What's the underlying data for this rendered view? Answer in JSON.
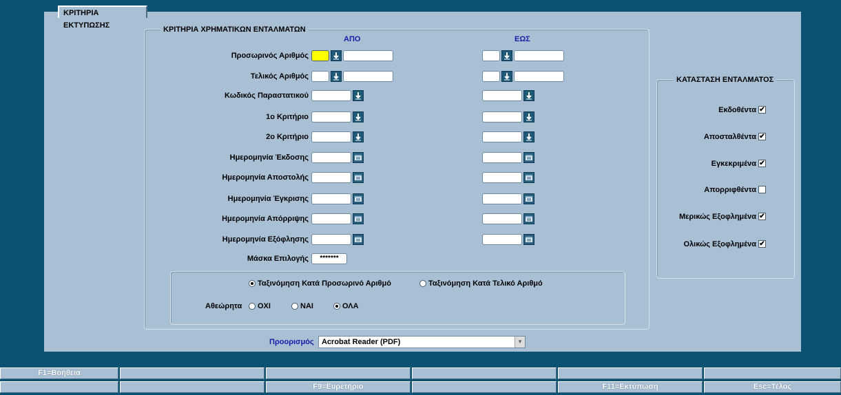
{
  "main_tab": "ΚΡΙΤΗΡΙΑ ΕΚΤΥΠΩΣΗΣ",
  "criteria": {
    "title": "ΚΡΙΤΗΡΙΑ ΧΡΗΜΑΤΙΚΩΝ ΕΝΤΑΛΜΑΤΩΝ",
    "from_label": "ΑΠΟ",
    "to_label": "ΕΩΣ",
    "rows": [
      {
        "label": "Προσωρινός Αριθμός",
        "type": "split-dropdown"
      },
      {
        "label": "Τελικός Αριθμός",
        "type": "split-dropdown"
      },
      {
        "label": "Κωδικός Παραστατικού",
        "type": "dropdown"
      },
      {
        "label": "1ο Κριτήριο",
        "type": "dropdown"
      },
      {
        "label": "2ο Κριτήριο",
        "type": "dropdown"
      },
      {
        "label": "Ημερομηνία Έκδοσης",
        "type": "date"
      },
      {
        "label": "Ημερομηνία Αποστολής",
        "type": "date"
      },
      {
        "label": "Ημερομηνία Έγκρισης",
        "type": "date"
      },
      {
        "label": "Ημερομηνία Απόρριψης",
        "type": "date"
      },
      {
        "label": "Ημερομηνία Εξόφλησης",
        "type": "date"
      }
    ],
    "mask_label": "Μάσκα Επιλογής",
    "mask_value": "*******"
  },
  "sort": {
    "option1": "Ταξινόμηση Κατά Προσωρινό Αριθμό",
    "option2": "Ταξινόμηση Κατά Τελικό Αριθμό",
    "selected": "option1"
  },
  "unchecked": {
    "label": "Αθεώρητα",
    "options": [
      "ΟΧΙ",
      "ΝΑΙ",
      "ΟΛΑ"
    ],
    "selected": "ΟΛΑ"
  },
  "status": {
    "title": "ΚΑΤΑΣΤΑΣΗ ΕΝΤΑΛΜΑΤΟΣ",
    "items": [
      {
        "label": "Εκδοθέντα",
        "checked": true
      },
      {
        "label": "Αποσταλθέντα",
        "checked": true
      },
      {
        "label": "Εγκεκριμένα",
        "checked": true
      },
      {
        "label": "Απορριφθέντα",
        "checked": false
      },
      {
        "label": "Μερικώς Εξοφλημένα",
        "checked": true
      },
      {
        "label": "Ολικώς Εξοφλημένα",
        "checked": true
      }
    ]
  },
  "destination": {
    "label": "Προορισμός",
    "value": "Acrobat Reader (PDF)"
  },
  "fkeys": {
    "row1": [
      "F1=Βοήθεια",
      "",
      "",
      "",
      "",
      ""
    ],
    "row2": [
      "",
      "",
      "F9=Ευρετήριο",
      "",
      "F11=Εκτύπωση",
      "Esc=Τέλος"
    ]
  },
  "colors": {
    "background": "#0b5272",
    "panel": "#a9bfd4",
    "highlight_field": "#ffff00",
    "label_blue": "#1a1aa8"
  }
}
